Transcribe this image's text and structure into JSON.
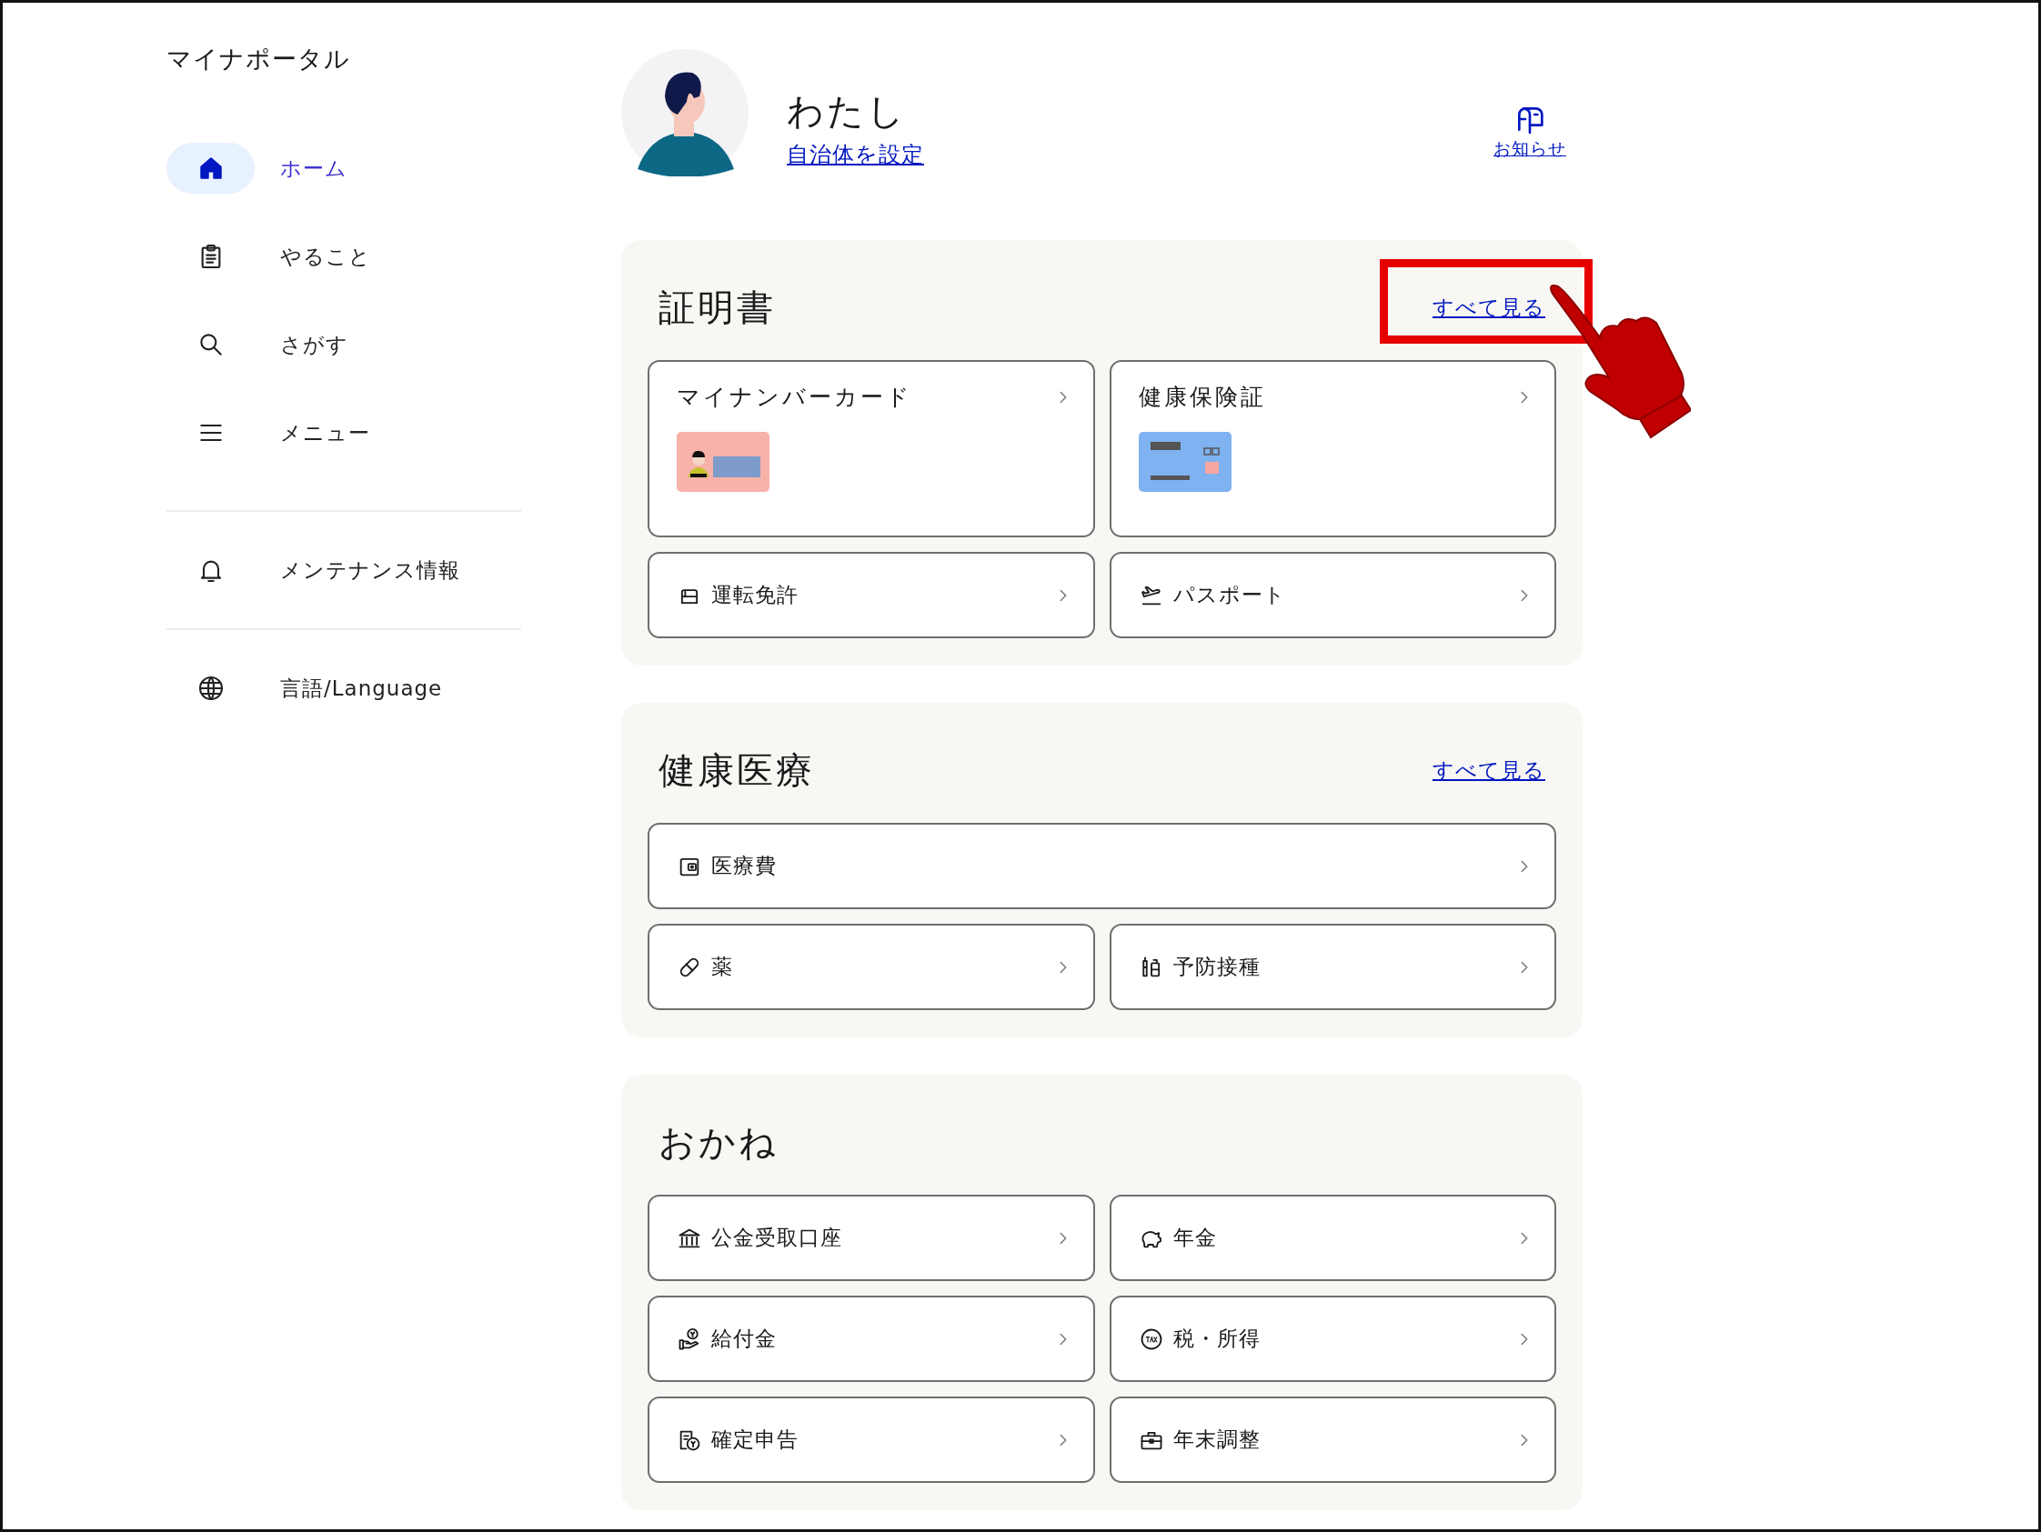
{
  "app_title": "マイナポータル",
  "nav_groups": [
    [
      {
        "label": "ホーム",
        "selected": true
      },
      {
        "label": "やること",
        "selected": false
      },
      {
        "label": "さがす",
        "selected": false
      },
      {
        "label": "メニュー",
        "selected": false
      }
    ],
    [
      {
        "label": "メンテナンス情報",
        "selected": false
      }
    ],
    [
      {
        "label": "言語/Language",
        "selected": false
      }
    ]
  ],
  "profile": {
    "name": "わたし",
    "link": "自治体を設定"
  },
  "notice": {
    "label": "お知らせ"
  },
  "sections": [
    {
      "title": "証明書",
      "see_all": {
        "label": "すべて見る",
        "highlighted": true
      },
      "items": [
        {
          "label": "マイナンバーカード",
          "kind": "card"
        },
        {
          "label": "健康保険証",
          "kind": "card"
        },
        {
          "label": "運転免許",
          "kind": "row"
        },
        {
          "label": "パスポート",
          "kind": "row"
        }
      ]
    },
    {
      "title": "健康医療",
      "see_all": {
        "label": "すべて見る",
        "highlighted": false
      },
      "items": [
        {
          "label": "医療費",
          "kind": "wide"
        },
        {
          "label": "薬",
          "kind": "row"
        },
        {
          "label": "予防接種",
          "kind": "row"
        }
      ]
    },
    {
      "title": "おかね",
      "items": [
        {
          "label": "公金受取口座",
          "kind": "row"
        },
        {
          "label": "年金",
          "kind": "row"
        },
        {
          "label": "給付金",
          "kind": "row"
        },
        {
          "label": "税・所得",
          "kind": "row"
        },
        {
          "label": "確定申告",
          "kind": "row"
        },
        {
          "label": "年末調整",
          "kind": "row"
        }
      ]
    }
  ]
}
